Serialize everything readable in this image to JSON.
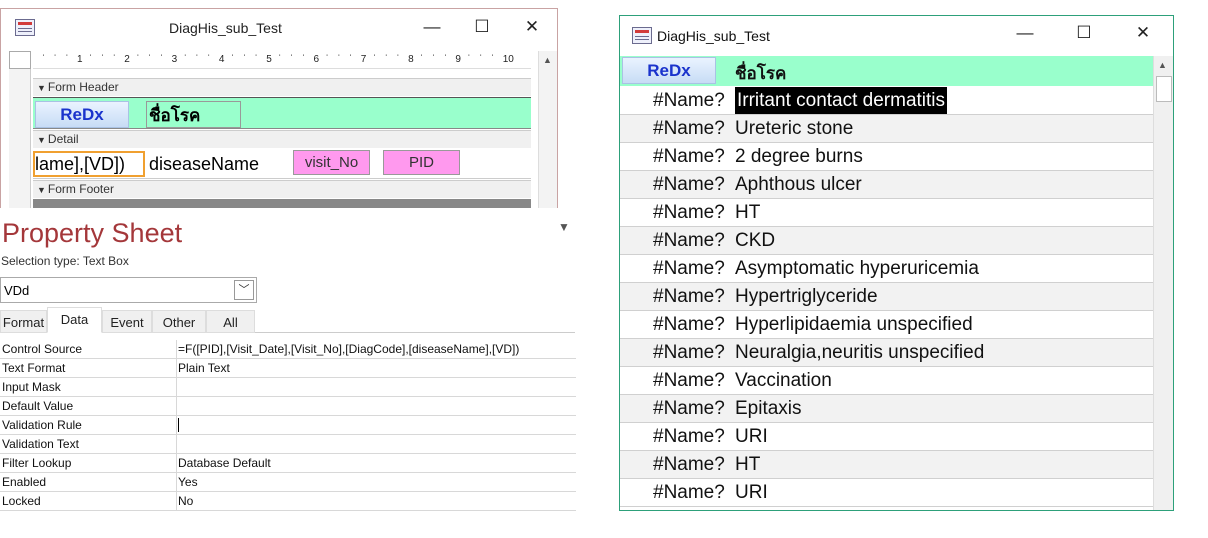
{
  "design_window": {
    "title": "DiagHis_sub_Test",
    "minimize": "—",
    "maximize": "☐",
    "close": "✕",
    "ruler_numbers": [
      "1",
      "2",
      "3",
      "4",
      "5",
      "6",
      "7",
      "8",
      "9",
      "10"
    ],
    "form_header_label": "Form Header",
    "detail_label": "Detail",
    "form_footer_label": "Form Footer",
    "redx_button": "ReDx",
    "header_label": "ชื่อโรค",
    "detail_expr": "lame],[VD])",
    "disease_field": "diseaseName",
    "visit_no_field": "visit_No",
    "pid_field": "PID"
  },
  "property_sheet": {
    "title": "Property Sheet",
    "selection_type": "Selection type:  Text Box",
    "selected_control": "VDd",
    "tabs": [
      "Format",
      "Data",
      "Event",
      "Other",
      "All"
    ],
    "active_tab": "Data",
    "rows": [
      {
        "key": "Control Source",
        "value": "=F([PID],[Visit_Date],[Visit_No],[DiagCode],[diseaseName],[VD])"
      },
      {
        "key": "Text Format",
        "value": "Plain Text"
      },
      {
        "key": "Input Mask",
        "value": ""
      },
      {
        "key": "Default Value",
        "value": ""
      },
      {
        "key": "Validation Rule",
        "value": ""
      },
      {
        "key": "Validation Text",
        "value": ""
      },
      {
        "key": "Filter Lookup",
        "value": "Database Default"
      },
      {
        "key": "Enabled",
        "value": "Yes"
      },
      {
        "key": "Locked",
        "value": "No"
      }
    ]
  },
  "form_window": {
    "title": "DiagHis_sub_Test",
    "minimize": "—",
    "maximize": "☐",
    "close": "✕",
    "redx_button": "ReDx",
    "header_label": "ชื่อโรค",
    "rows": [
      {
        "name": "#Name?",
        "disease": "Irritant contact dermatitis"
      },
      {
        "name": "#Name?",
        "disease": "Ureteric stone"
      },
      {
        "name": "#Name?",
        "disease": "2 degree burns"
      },
      {
        "name": "#Name?",
        "disease": "Aphthous ulcer"
      },
      {
        "name": "#Name?",
        "disease": "HT"
      },
      {
        "name": "#Name?",
        "disease": "CKD"
      },
      {
        "name": "#Name?",
        "disease": "Asymptomatic hyperuricemia"
      },
      {
        "name": "#Name?",
        "disease": "Hypertriglyceride"
      },
      {
        "name": "#Name?",
        "disease": "Hyperlipidaemia unspecified"
      },
      {
        "name": "#Name?",
        "disease": "Neuralgia,neuritis unspecified"
      },
      {
        "name": "#Name?",
        "disease": "Vaccination"
      },
      {
        "name": "#Name?",
        "disease": "Epitaxis"
      },
      {
        "name": "#Name?",
        "disease": "URI"
      },
      {
        "name": "#Name?",
        "disease": "HT"
      },
      {
        "name": "#Name?",
        "disease": "URI"
      }
    ]
  },
  "colors": {
    "header_bg": "#99ffcc",
    "control_pink": "#ff99ee",
    "redx_text": "#1a33cc",
    "ps_title": "#a4373a",
    "form_border": "#2da07a"
  }
}
